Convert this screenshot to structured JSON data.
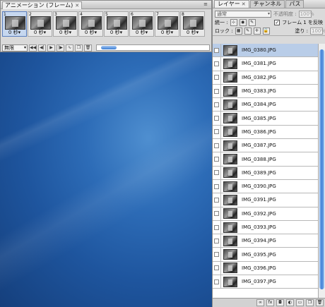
{
  "animation_panel": {
    "tab_title": "アニメーション (フレーム)",
    "frames": [
      {
        "num": "1",
        "delay": "0 秒▾"
      },
      {
        "num": "2",
        "delay": "0 秒▾"
      },
      {
        "num": "3",
        "delay": "0 秒▾"
      },
      {
        "num": "4",
        "delay": "0 秒▾"
      },
      {
        "num": "5",
        "delay": "0 秒▾"
      },
      {
        "num": "6",
        "delay": "0 秒▾"
      },
      {
        "num": "7",
        "delay": "0 秒▾"
      },
      {
        "num": "8",
        "delay": "0 秒▾"
      }
    ],
    "loop_value": "無限"
  },
  "layers_panel": {
    "tabs": [
      "レイヤー",
      "チャンネル",
      "パス"
    ],
    "blend_mode": "通常",
    "opacity_label": "不透明度 :",
    "opacity_value": "100%",
    "unify_label": "統一 :",
    "propagate_label": "フレーム 1 を反映",
    "lock_label": "ロック :",
    "fill_label": "塗り :",
    "fill_value": "100%",
    "layers": [
      "IMG_0380.JPG",
      "IMG_0381.JPG",
      "IMG_0382.JPG",
      "IMG_0383.JPG",
      "IMG_0384.JPG",
      "IMG_0385.JPG",
      "IMG_0386.JPG",
      "IMG_0387.JPG",
      "IMG_0388.JPG",
      "IMG_0389.JPG",
      "IMG_0390.JPG",
      "IMG_0391.JPG",
      "IMG_0392.JPG",
      "IMG_0393.JPG",
      "IMG_0394.JPG",
      "IMG_0395.JPG",
      "IMG_0396.JPG",
      "IMG_0397.JPG"
    ]
  }
}
